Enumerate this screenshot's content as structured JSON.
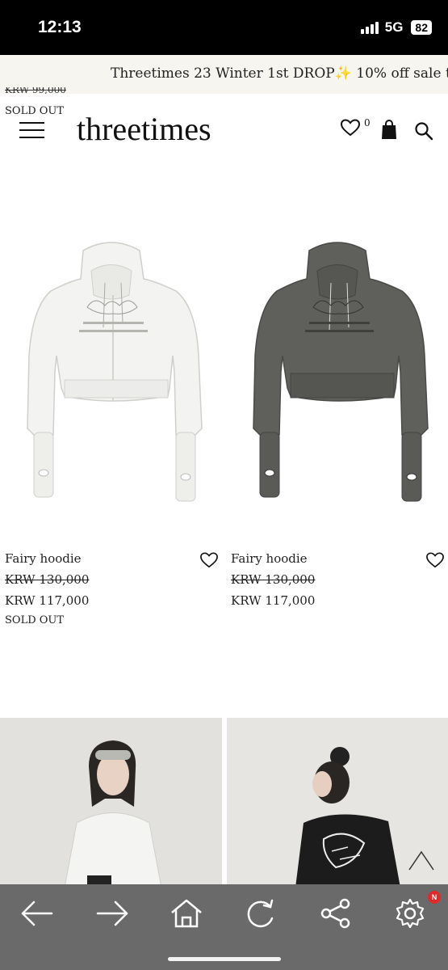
{
  "status_bar": {
    "time": "12:13",
    "network": "5G",
    "battery": "82"
  },
  "announcement": {
    "text": "Threetimes 23 Winter 1st DROP✨ 10% off sale throu"
  },
  "top_partial": {
    "price_cut": "KRW 99,000",
    "sold_out": "SOLD OUT"
  },
  "header": {
    "logo": "threetimes",
    "wishlist_count": "0"
  },
  "products": [
    {
      "name": "Fairy hoodie",
      "original_price": "KRW 130,000",
      "sale_price": "KRW 117,000",
      "status": "SOLD OUT",
      "color": "white"
    },
    {
      "name": "Fairy hoodie",
      "original_price": "KRW 130,000",
      "sale_price": "KRW 117,000",
      "status": "",
      "color": "charcoal"
    }
  ],
  "colors": {
    "accent_dark": "#111111",
    "bottom_bar": "#6a6a6a",
    "announce_bg": "#f7f5ef",
    "badge": "#e02a2a"
  },
  "bottom_nav": {
    "badge": "N",
    "icons": [
      "back-icon",
      "forward-icon",
      "home-icon",
      "refresh-icon",
      "share-icon",
      "settings-icon"
    ]
  }
}
